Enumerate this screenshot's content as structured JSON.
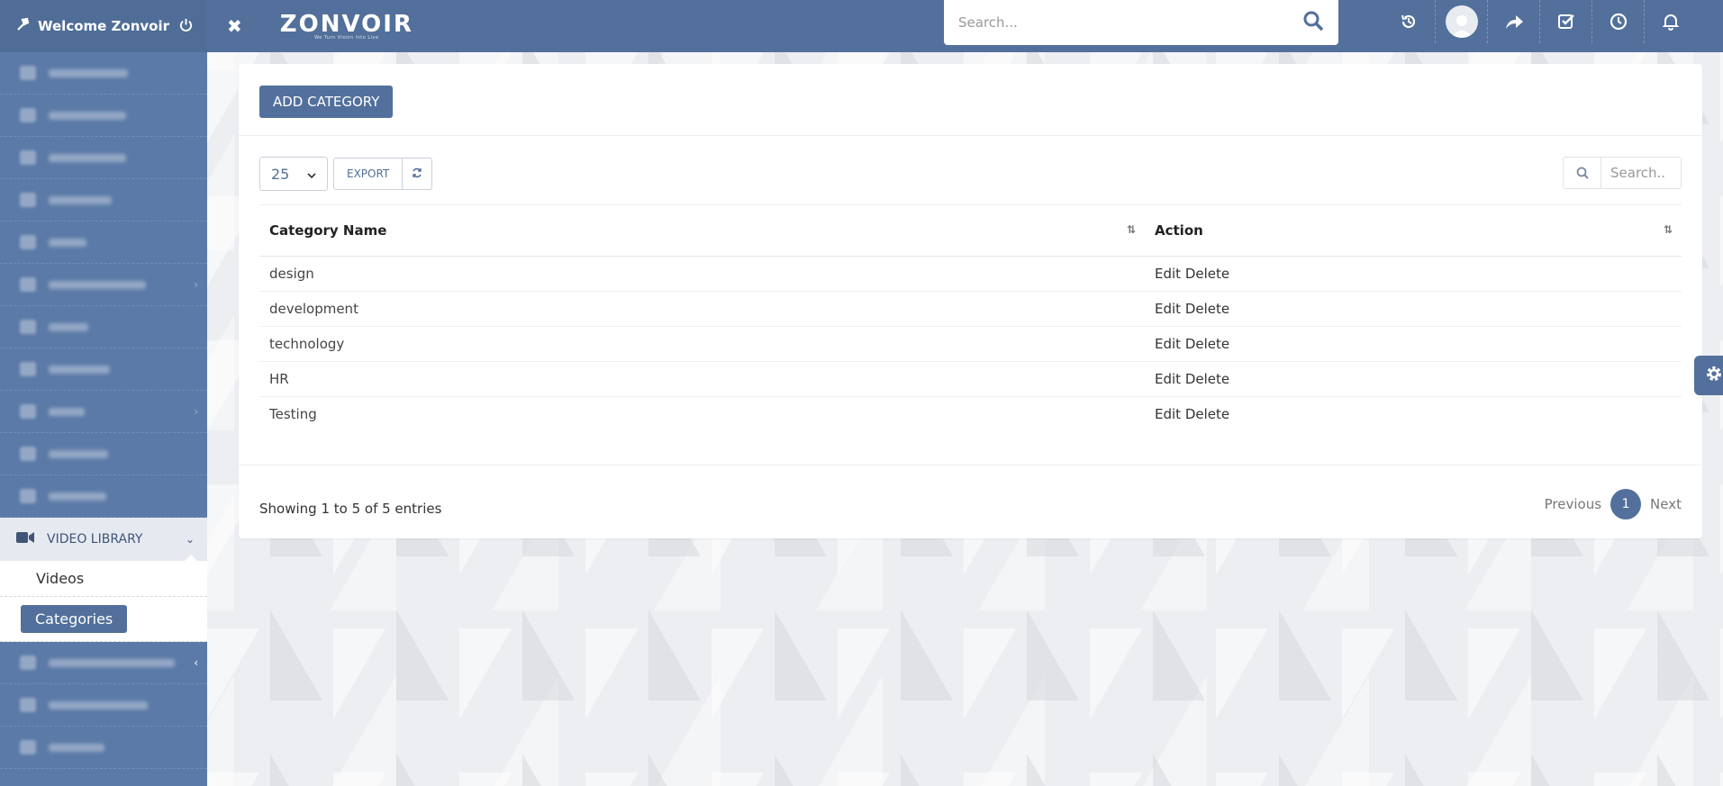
{
  "topbar": {
    "welcome": "Welcome Zonvoir",
    "logo": "ZONVOIR",
    "logo_tagline": "We Turn Vision Into Live",
    "search_placeholder": "Search..."
  },
  "sidebar": {
    "active_section": "VIDEO LIBRARY",
    "sub_items": [
      "Videos",
      "Categories"
    ]
  },
  "page": {
    "add_button": "ADD CATEGORY",
    "page_length": "25",
    "export_label": "EXPORT",
    "table_search_placeholder": "Search.."
  },
  "table": {
    "headers": [
      "Category Name",
      "Action"
    ],
    "rows": [
      {
        "name": "design",
        "edit": "Edit",
        "delete": "Delete"
      },
      {
        "name": "development",
        "edit": "Edit",
        "delete": "Delete"
      },
      {
        "name": "technology",
        "edit": "Edit",
        "delete": "Delete"
      },
      {
        "name": "HR",
        "edit": "Edit",
        "delete": "Delete"
      },
      {
        "name": "Testing",
        "edit": "Edit",
        "delete": "Delete"
      }
    ]
  },
  "footer": {
    "info": "Showing 1 to 5 of 5 entries",
    "previous": "Previous",
    "current_page": "1",
    "next": "Next"
  },
  "colors": {
    "brand": "#52709b",
    "sidebar": "#5b7aa7"
  }
}
